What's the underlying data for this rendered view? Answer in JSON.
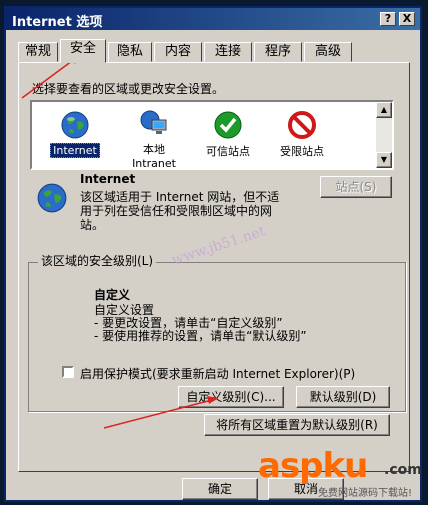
{
  "window": {
    "title": "Internet 选项",
    "help_label": "?",
    "close_label": "X"
  },
  "tabs": [
    "常规",
    "安全",
    "隐私",
    "内容",
    "连接",
    "程序",
    "高级"
  ],
  "zones": {
    "instruction": "选择要查看的区域或更改安全设置。",
    "items": [
      {
        "label": "Internet",
        "label2": "",
        "icon": "globe-icon"
      },
      {
        "label": "本地",
        "label2": "Intranet",
        "icon": "intranet-icon"
      },
      {
        "label": "可信站点",
        "label2": "",
        "icon": "trusted-check-icon"
      },
      {
        "label": "受限站点",
        "label2": "",
        "icon": "restricted-icon"
      }
    ]
  },
  "zone_info": {
    "name": "Internet",
    "description": "该区域适用于 Internet 网站，但不适用于列在受信任和受限制区域中的网站。",
    "sites_button": "站点(S)"
  },
  "security_level": {
    "group_label": "该区域的安全级别(L)",
    "level_title": "自定义",
    "lines": [
      "自定义设置",
      "- 要更改设置，请单击“自定义级别”",
      "- 要使用推荐的设置，请单击“默认级别”"
    ],
    "protected_mode_label": "启用保护模式(要求重新启动 Internet Explorer)(P)",
    "protected_mode_checked": false,
    "custom_level_button": "自定义级别(C)...",
    "default_level_button": "默认级别(D)",
    "reset_all_button": "将所有区域重置为默认级别(R)"
  },
  "footer": {
    "ok_button": "确定",
    "cancel_button": "取消"
  },
  "watermarks": {
    "jb51": "www.jb51.net",
    "aspku": "aspku",
    "aspku_com": ".com",
    "aspku_sub": "免费网站源码下载站!"
  },
  "colors": {
    "titlebar": "#0a246a",
    "selection": "#0a246a",
    "restricted": "#d01818",
    "trusted": "#1c9a2a",
    "annotation_arrow": "#e02020",
    "aspku_orange": "#ff6a00"
  }
}
